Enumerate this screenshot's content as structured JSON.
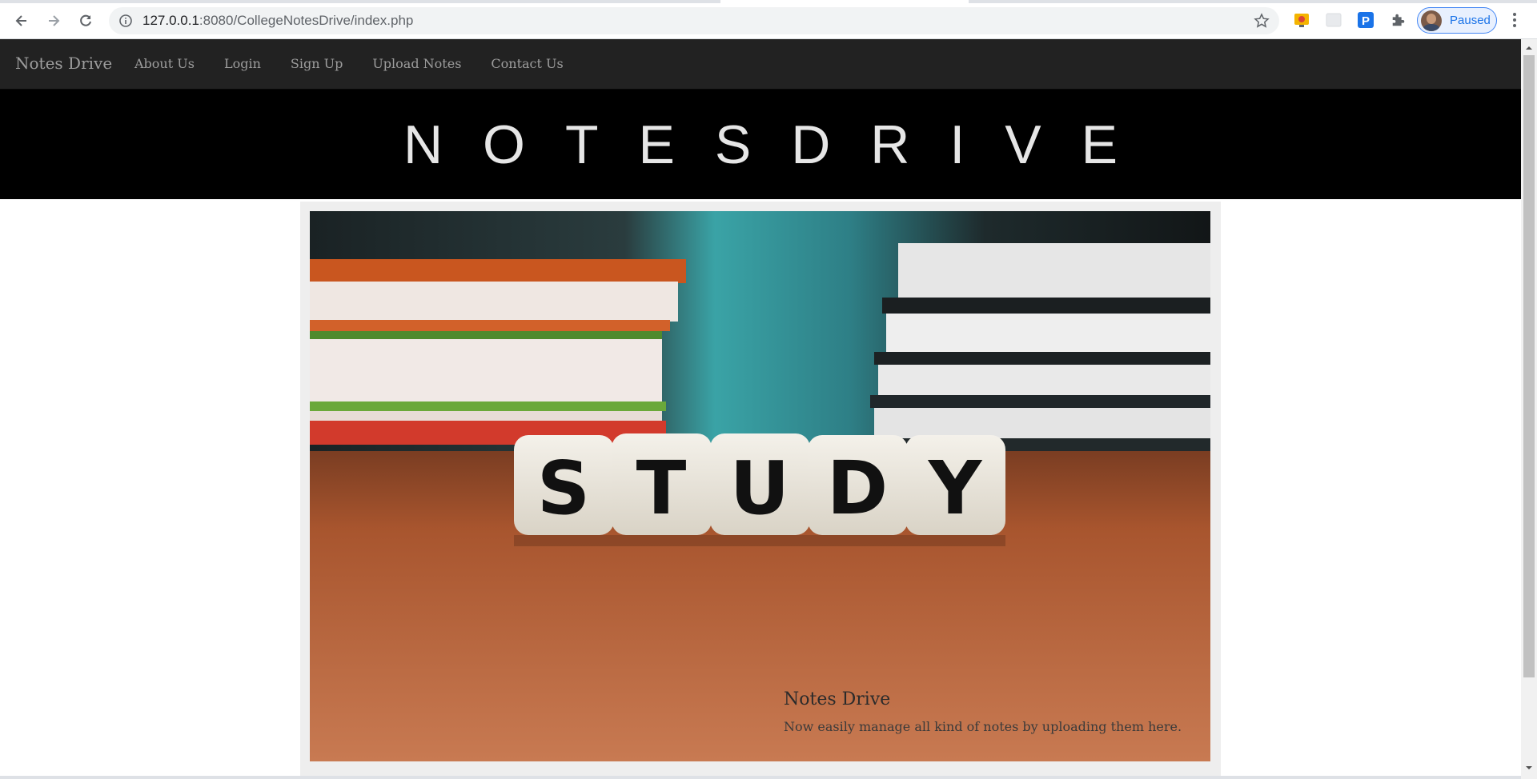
{
  "browser": {
    "url_host": "127.0.0.1",
    "url_path": ":8080/CollegeNotesDrive/index.php",
    "profile_status": "Paused",
    "icons": [
      "back-icon",
      "forward-icon",
      "reload-icon",
      "info-icon",
      "star-icon",
      "extension-icon",
      "puzzle-icon",
      "more-icon"
    ]
  },
  "navbar": {
    "brand": "Notes Drive",
    "links": [
      "About Us",
      "Login",
      "Sign Up",
      "Upload Notes",
      "Contact Us"
    ],
    "background": "#222222",
    "link_color": "#9d9d9d"
  },
  "hero": {
    "title": "NOTESDRIVE",
    "background": "#000000"
  },
  "carousel": {
    "image_letters": [
      "S",
      "T",
      "U",
      "D",
      "Y"
    ],
    "caption_title": "Notes Drive",
    "caption_text": "Now easily manage all kind of notes by uploading them here."
  }
}
